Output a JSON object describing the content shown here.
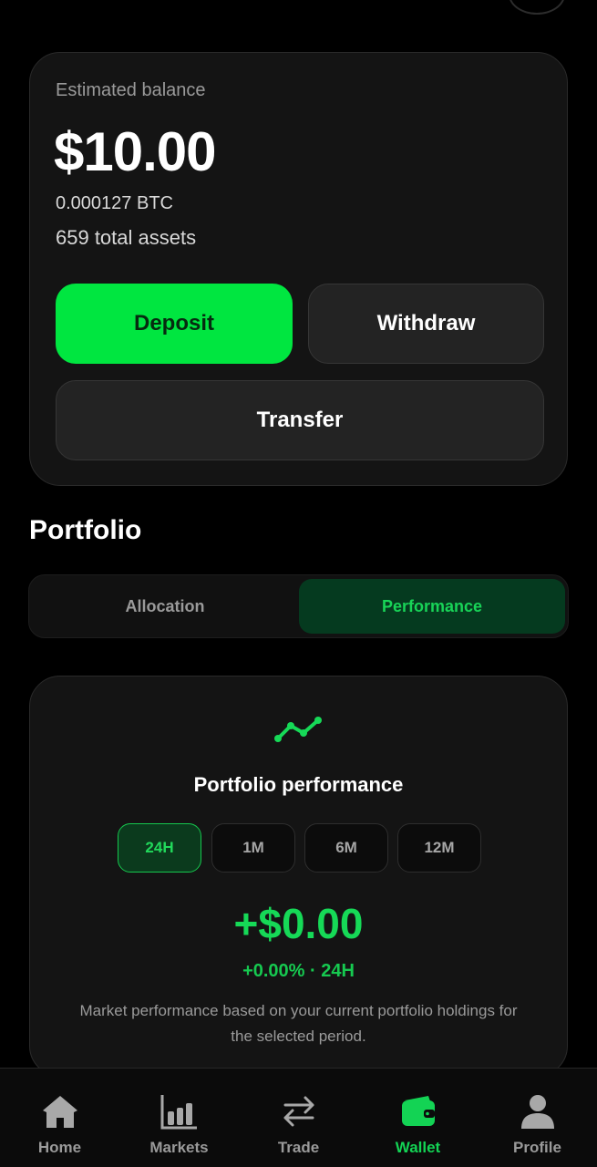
{
  "balance": {
    "label": "Estimated balance",
    "value": "$10.00",
    "btc": "0.000127 BTC",
    "assets": "659 total assets",
    "buttons": {
      "deposit": "Deposit",
      "withdraw": "Withdraw",
      "transfer": "Transfer"
    }
  },
  "portfolio": {
    "title": "Portfolio",
    "tabs": [
      {
        "label": "Allocation",
        "active": false
      },
      {
        "label": "Performance",
        "active": true
      }
    ],
    "performance": {
      "icon": "trend-line-icon",
      "title": "Portfolio performance",
      "ranges": [
        {
          "label": "24H",
          "active": true
        },
        {
          "label": "1M",
          "active": false
        },
        {
          "label": "6M",
          "active": false
        },
        {
          "label": "12M",
          "active": false
        }
      ],
      "value": "+$0.00",
      "change": "+0.00% · 24H",
      "description": "Market performance based on your current portfolio holdings for the selected period."
    }
  },
  "nav": {
    "items": [
      {
        "label": "Home",
        "icon": "home-icon",
        "active": false
      },
      {
        "label": "Markets",
        "icon": "bar-chart-icon",
        "active": false
      },
      {
        "label": "Trade",
        "icon": "swap-arrows-icon",
        "active": false
      },
      {
        "label": "Wallet",
        "icon": "wallet-icon",
        "active": true
      },
      {
        "label": "Profile",
        "icon": "user-icon",
        "active": false
      }
    ]
  },
  "colors": {
    "accent": "#00e640",
    "accent_dark": "#053a1f",
    "background": "#000000",
    "card": "#141414",
    "muted_text": "#9a9a9a"
  }
}
